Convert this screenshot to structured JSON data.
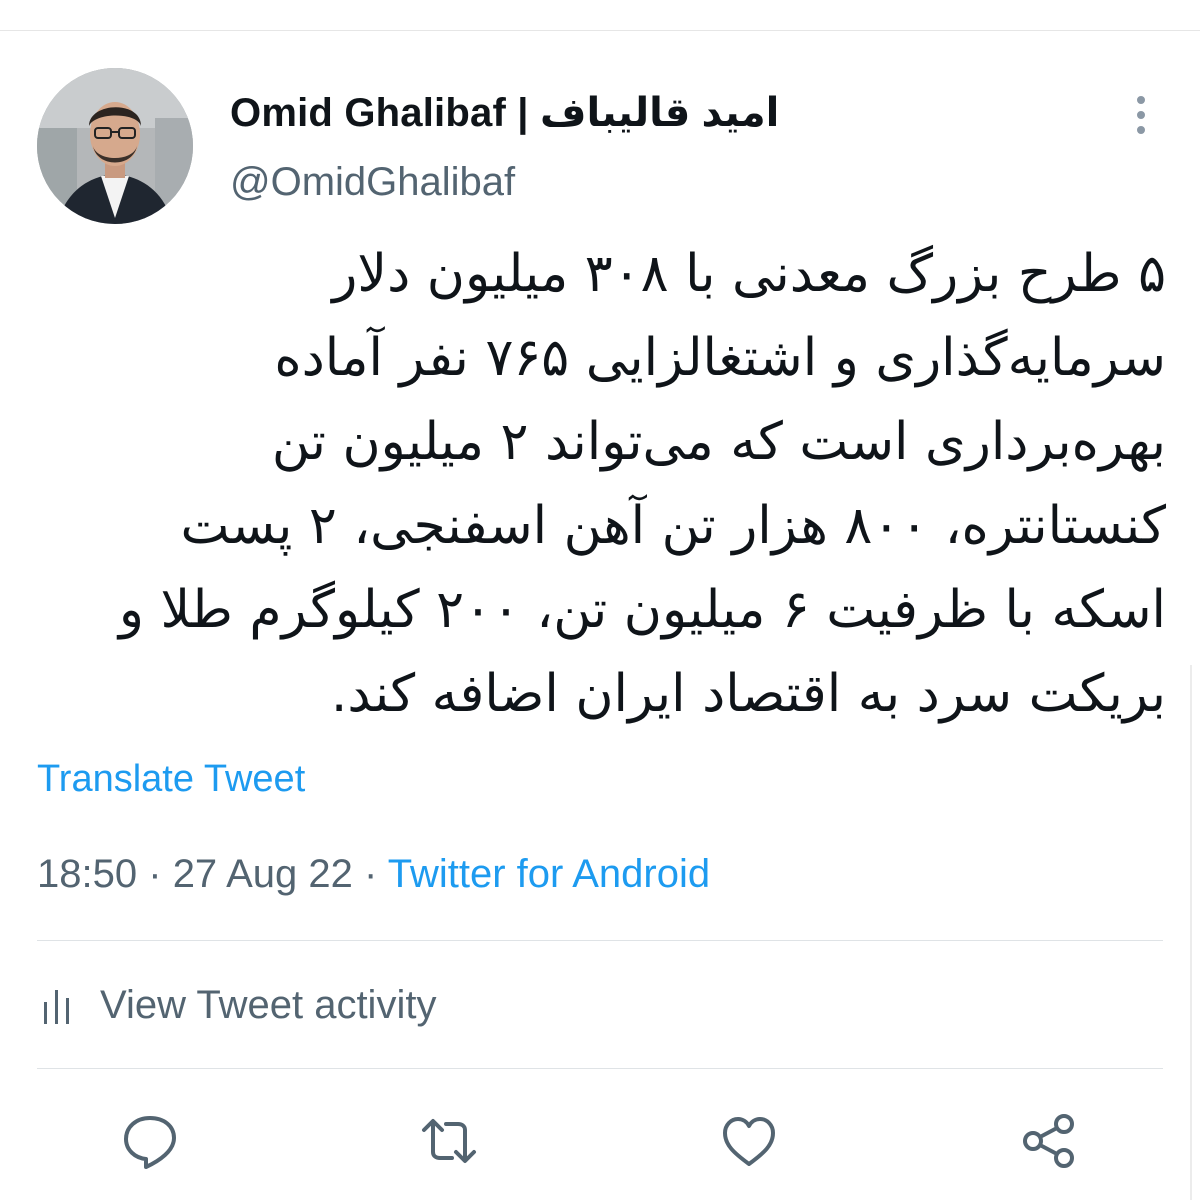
{
  "tweet": {
    "display_name": "Omid Ghalibaf | امید قالیباف",
    "handle": "@OmidGhalibaf",
    "text_lines": [
      "۵ طرح بزرگ معدنی با ۳۰۸ میلیون دلار",
      "سرمایه‌گذاری و اشتغالزایی ۷۶۵ نفر آماده",
      "بهره‌برداری است که می‌تواند ۲ میلیون تن",
      "کنستانتره، ۸۰۰ هزار تن آهن اسفنجی، ۲ پست",
      "اسکه با ظرفیت ۶ میلیون تن، ۲۰۰ کیلوگرم طلا و",
      "بریکت سرد به اقتصاد ایران اضافه کند."
    ],
    "translate_label": "Translate Tweet",
    "time": "18:50",
    "separator": "·",
    "date": "27 Aug 22",
    "source": "Twitter for Android"
  },
  "activity": {
    "label": "View Tweet activity",
    "icon": "bar-chart-icon"
  },
  "actions": {
    "reply_icon": "reply-icon",
    "retweet_icon": "retweet-icon",
    "like_icon": "like-icon",
    "share_icon": "share-icon"
  },
  "colors": {
    "accent": "#1d9bf0",
    "text_primary": "#0f1419",
    "text_secondary": "#536471",
    "divider": "#dfe3e6"
  }
}
